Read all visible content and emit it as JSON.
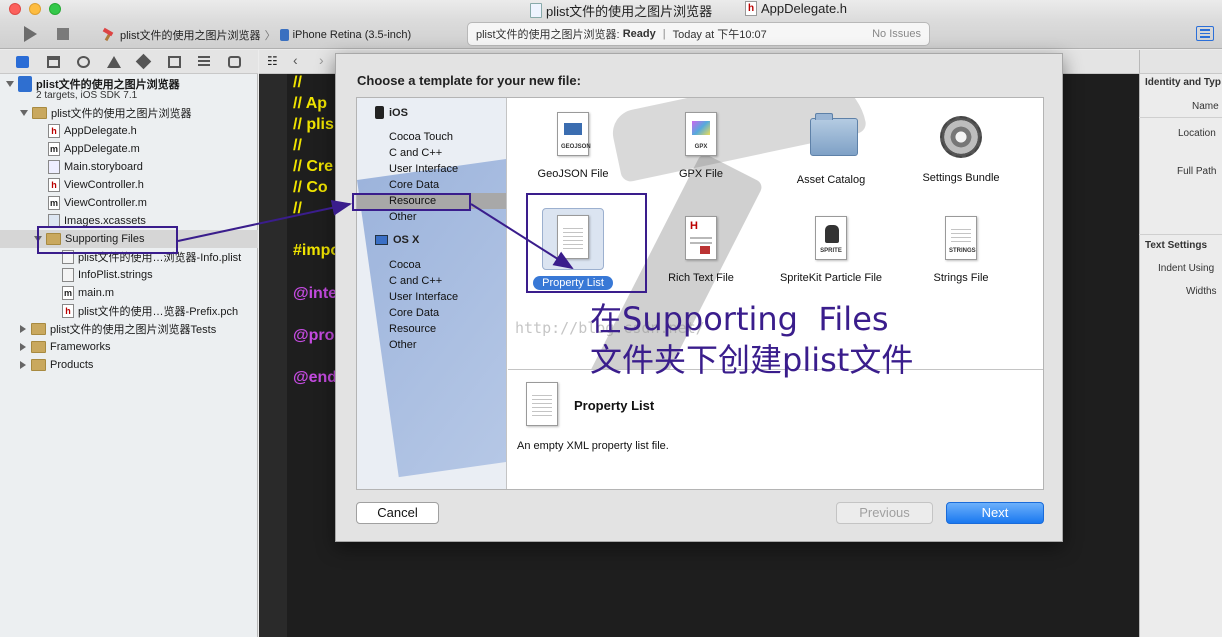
{
  "window": {
    "tab_project": "plist文件的使用之图片浏览器",
    "tab_file": "AppDelegate.h"
  },
  "toolbar": {
    "scheme": "plist文件的使用之图片浏览器",
    "destination": "iPhone Retina (3.5-inch)",
    "activity": {
      "project": "plist文件的使用之图片浏览器:",
      "status": "Ready",
      "time": "Today at 下午10:07",
      "issues": "No Issues"
    }
  },
  "navigator": {
    "project": {
      "name": "plist文件的使用之图片浏览器",
      "subtitle": "2 targets, iOS SDK 7.1"
    },
    "group_main": "plist文件的使用之图片浏览器",
    "files": [
      {
        "name": "AppDelegate.h",
        "type": "h"
      },
      {
        "name": "AppDelegate.m",
        "type": "m"
      },
      {
        "name": "Main.storyboard",
        "type": "sb"
      },
      {
        "name": "ViewController.h",
        "type": "h"
      },
      {
        "name": "ViewController.m",
        "type": "m"
      },
      {
        "name": "Images.xcassets",
        "type": "xc"
      }
    ],
    "supporting_files": "Supporting Files",
    "supporting_children": [
      {
        "name": "plist文件的使用…浏览器-Info.plist",
        "type": "pl"
      },
      {
        "name": "InfoPlist.strings",
        "type": "pl"
      },
      {
        "name": "main.m",
        "type": "m"
      },
      {
        "name": "plist文件的使用…览器-Prefix.pch",
        "type": "h"
      }
    ],
    "groups_bottom": [
      "plist文件的使用之图片浏览器Tests",
      "Frameworks",
      "Products"
    ]
  },
  "editor": {
    "lines": [
      "//",
      "//  Ap",
      "//  plis",
      "//",
      "//  Cre",
      "//  Co",
      "//",
      "#impo",
      "@inte",
      "@pro",
      "@end"
    ]
  },
  "inspector": {
    "identity_title": "Identity and Typ",
    "name_label": "Name",
    "location_label": "Location",
    "full_path_label": "Full Path",
    "text_settings_title": "Text Settings",
    "indent_label": "Indent Using",
    "widths_label": "Widths"
  },
  "sheet": {
    "title": "Choose a template for your new file:",
    "ios_label": "iOS",
    "ios_items": [
      "Cocoa Touch",
      "C and C++",
      "User Interface",
      "Core Data",
      "Resource",
      "Other"
    ],
    "osx_label": "OS X",
    "osx_items": [
      "Cocoa",
      "C and C++",
      "User Interface",
      "Core Data",
      "Resource",
      "Other"
    ],
    "selected_category": "Resource",
    "templates": [
      {
        "label": "GeoJSON File",
        "icon": "geojson-icon",
        "tag": "GEOJSON"
      },
      {
        "label": "GPX File",
        "icon": "gpx-icon",
        "tag": "GPX"
      },
      {
        "label": "Asset Catalog",
        "icon": "asset-catalog-icon"
      },
      {
        "label": "Settings Bundle",
        "icon": "settings-bundle-icon"
      },
      {
        "label": "Property List",
        "icon": "property-list-icon"
      },
      {
        "label": "Rich Text File",
        "icon": "rich-text-icon"
      },
      {
        "label": "SpriteKit Particle File",
        "icon": "spritekit-icon",
        "tag": "SPRITE"
      },
      {
        "label": "Strings File",
        "icon": "strings-icon",
        "tag": "STRINGS"
      }
    ],
    "selected_template": "Property List",
    "description_title": "Property List",
    "description_text": "An empty XML property list file.",
    "buttons": {
      "cancel": "Cancel",
      "previous": "Previous",
      "next": "Next"
    }
  },
  "annotation": {
    "line1": "在Supporting  Files",
    "line2": "文件夹下创建plist文件",
    "color": "#3a1d8c"
  },
  "watermark": "http://blog.csdn.net/"
}
